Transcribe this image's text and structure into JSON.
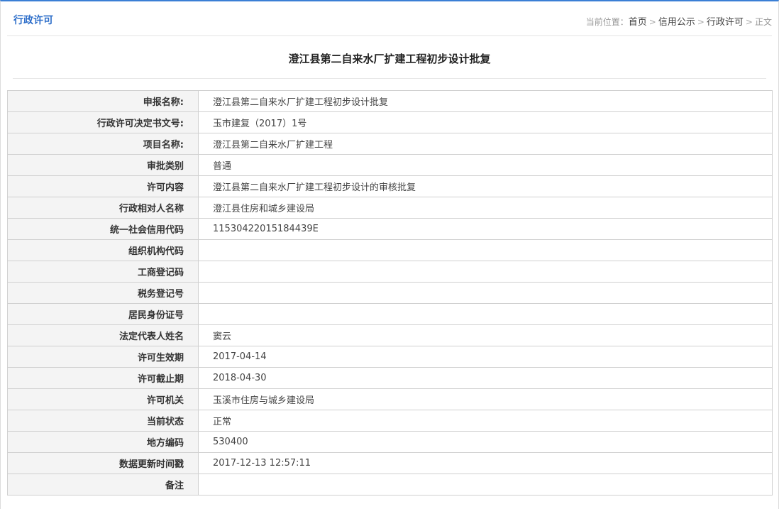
{
  "header": {
    "title": "行政许可",
    "breadcrumb": {
      "label": "当前位置：",
      "items": [
        "首页",
        "信用公示",
        "行政许可"
      ],
      "separator": ">",
      "current": "正文"
    }
  },
  "page_title": "澄江县第二自来水厂扩建工程初步设计批复",
  "rows": [
    {
      "key": "申报名称:",
      "value": "澄江县第二自来水厂扩建工程初步设计批复"
    },
    {
      "key": "行政许可决定书文号:",
      "value": "玉市建复（2017）1号"
    },
    {
      "key": "项目名称:",
      "value": "澄江县第二自来水厂扩建工程"
    },
    {
      "key": "审批类别",
      "value": "普通"
    },
    {
      "key": "许可内容",
      "value": "澄江县第二自来水厂扩建工程初步设计的审核批复"
    },
    {
      "key": "行政相对人名称",
      "value": "澄江县住房和城乡建设局"
    },
    {
      "key": "统一社会信用代码",
      "value": "11530422015184439E"
    },
    {
      "key": "组织机构代码",
      "value": ""
    },
    {
      "key": "工商登记码",
      "value": ""
    },
    {
      "key": "税务登记号",
      "value": ""
    },
    {
      "key": "居民身份证号",
      "value": ""
    },
    {
      "key": "法定代表人姓名",
      "value": "窦云"
    },
    {
      "key": "许可生效期",
      "value": "2017-04-14"
    },
    {
      "key": "许可截止期",
      "value": "2018-04-30"
    },
    {
      "key": "许可机关",
      "value": "玉溪市住房与城乡建设局"
    },
    {
      "key": "当前状态",
      "value": "正常"
    },
    {
      "key": "地方编码",
      "value": "530400"
    },
    {
      "key": "数据更新时间戳",
      "value": "2017-12-13 12:57:11"
    },
    {
      "key": "备注",
      "value": ""
    }
  ]
}
